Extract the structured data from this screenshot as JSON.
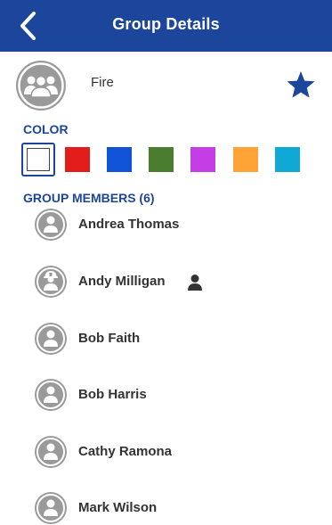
{
  "header": {
    "title": "Group Details"
  },
  "group": {
    "name": "Fire",
    "favorite": true
  },
  "color_section": {
    "label": "COLOR",
    "swatches": [
      {
        "color": "#ffffff",
        "selected": true
      },
      {
        "color": "#e31c1c",
        "selected": false
      },
      {
        "color": "#1153d6",
        "selected": false
      },
      {
        "color": "#4a7d30",
        "selected": false
      },
      {
        "color": "#c43ee6",
        "selected": false
      },
      {
        "color": "#fea436",
        "selected": false
      },
      {
        "color": "#10a9d6",
        "selected": false
      }
    ]
  },
  "members_section": {
    "label": "GROUP MEMBERS (6)",
    "members": [
      {
        "name": "Andrea Thomas",
        "avatar_icon": "user-avatar-icon",
        "has_person_badge": false
      },
      {
        "name": "Andy Milligan",
        "avatar_icon": "firefighter-avatar-icon",
        "has_person_badge": true
      },
      {
        "name": "Bob Faith",
        "avatar_icon": "user-avatar-icon",
        "has_person_badge": false
      },
      {
        "name": "Bob Harris",
        "avatar_icon": "user-avatar-icon",
        "has_person_badge": false
      },
      {
        "name": "Cathy Ramona",
        "avatar_icon": "user-avatar-icon",
        "has_person_badge": false
      },
      {
        "name": "Mark Wilson",
        "avatar_icon": "user-avatar-icon",
        "has_person_badge": false
      }
    ]
  },
  "colors": {
    "brand": "#1c469c",
    "avatar_gray": "#9a9a9a"
  }
}
